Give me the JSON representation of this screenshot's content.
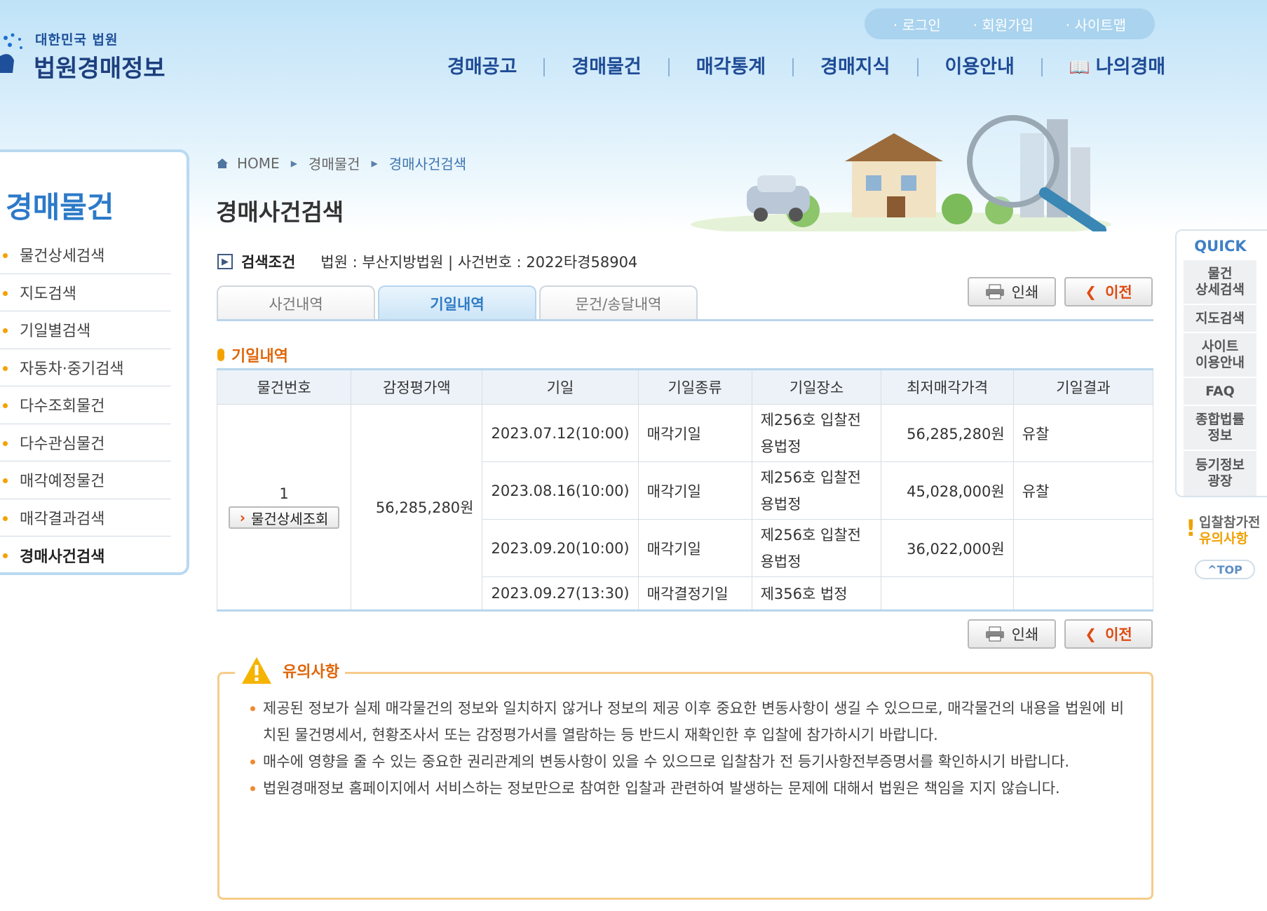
{
  "brand": {
    "sub": "대한민국 법원",
    "main": "법원경매정보"
  },
  "util_links": [
    "로그인",
    "회원가입",
    "사이트맵"
  ],
  "gnb": [
    "경매공고",
    "경매물건",
    "매각통계",
    "경매지식",
    "이용안내",
    "나의경매"
  ],
  "sidebar": {
    "title": "경매물건",
    "items": [
      "물건상세검색",
      "지도검색",
      "기일별검색",
      "자동차·중기검색",
      "다수조회물건",
      "다수관심물건",
      "매각예정물건",
      "매각결과검색",
      "경매사건검색"
    ],
    "active": "경매사건검색"
  },
  "breadcrumb": [
    "HOME",
    "경매물건",
    "경매사건검색"
  ],
  "page_title": "경매사건검색",
  "search_cond": {
    "label": "검색조건",
    "value": "법원 : 부산지방법원 | 사건번호 : 2022타경58904"
  },
  "tabs": [
    "사건내역",
    "기일내역",
    "문건/송달내역"
  ],
  "buttons": {
    "print": "인쇄",
    "prev": "이전"
  },
  "section_title": "기일내역",
  "table": {
    "headers": [
      "물건번호",
      "감정평가액",
      "기일",
      "기일종류",
      "기일장소",
      "최저매각가격",
      "기일결과"
    ],
    "item_no": "1",
    "detail_button": "물건상세조회",
    "appraisal": "56,285,280원",
    "rows": [
      {
        "date": "2023.07.12(10:00)",
        "type": "매각기일",
        "place": "제256호 입찰전용법정",
        "min_price": "56,285,280원",
        "result": "유찰"
      },
      {
        "date": "2023.08.16(10:00)",
        "type": "매각기일",
        "place": "제256호 입찰전용법정",
        "min_price": "45,028,000원",
        "result": "유찰"
      },
      {
        "date": "2023.09.20(10:00)",
        "type": "매각기일",
        "place": "제256호 입찰전용법정",
        "min_price": "36,022,000원",
        "result": ""
      },
      {
        "date": "2023.09.27(13:30)",
        "type": "매각결정기일",
        "place": "제356호 법정",
        "min_price": "",
        "result": ""
      }
    ]
  },
  "notice": {
    "title": "유의사항",
    "items": [
      "제공된 정보가 실제 매각물건의 정보와 일치하지 않거나 정보의 제공 이후 중요한 변동사항이 생길 수 있으므로, 매각물건의 내용을 법원에 비치된 물건명세서, 현황조사서 또는 감정평가서를 열람하는 등 반드시 재확인한 후 입찰에 참가하시기 바랍니다.",
      "매수에 영향을 줄 수 있는 중요한 권리관계의 변동사항이 있을 수 있으므로 입찰참가 전 등기사항전부증명서를 확인하시기 바랍니다.",
      "법원경매정보 홈페이지에서 서비스하는 정보만으로 참여한 입찰과 관련하여 발생하는 문제에 대해서 법원은 책임을 지지 않습니다."
    ]
  },
  "quick": {
    "title": "QUICK",
    "items": [
      [
        "물건",
        "상세검색"
      ],
      [
        "지도검색"
      ],
      [
        "사이트",
        "이용안내"
      ],
      [
        "FAQ"
      ],
      [
        "종합법률",
        "정보"
      ],
      [
        "등기정보",
        "광장"
      ]
    ],
    "notice_line1": "입찰참가전",
    "notice_line2": "유의사항",
    "top": "TOP"
  },
  "colors": {
    "accent": "#2f7bc5",
    "nav": "#1f4b96",
    "orange": "#e0650a",
    "notice_border": "#f6cc8a"
  }
}
